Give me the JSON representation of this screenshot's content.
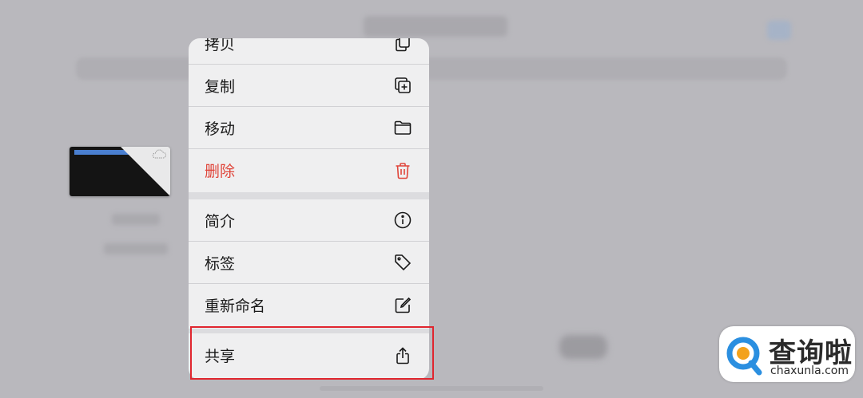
{
  "menu": {
    "items": [
      {
        "label": "拷贝",
        "icon": "copy-icon"
      },
      {
        "label": "复制",
        "icon": "duplicate-icon"
      },
      {
        "label": "移动",
        "icon": "folder-icon"
      },
      {
        "label": "删除",
        "icon": "trash-icon",
        "destructive": true
      },
      {
        "label": "简介",
        "icon": "info-icon"
      },
      {
        "label": "标签",
        "icon": "tag-icon"
      },
      {
        "label": "重新命名",
        "icon": "rename-icon"
      },
      {
        "label": "共享",
        "icon": "share-icon"
      }
    ]
  },
  "colors": {
    "destructive": "#e0453a",
    "highlight": "#e0262f",
    "menu_bg": "#efeff0"
  },
  "watermark": {
    "zh": "查询啦",
    "en": "chaxunla.com"
  }
}
